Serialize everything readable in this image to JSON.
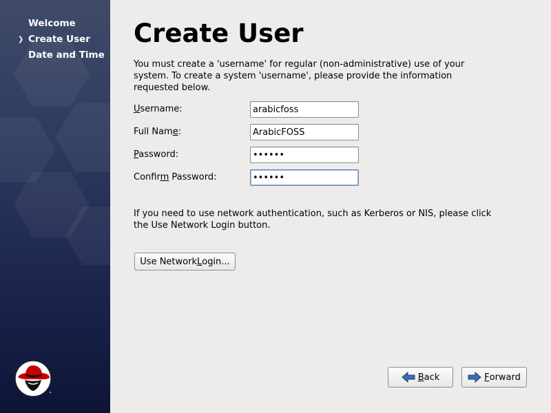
{
  "sidebar": {
    "items": [
      {
        "label": "Welcome",
        "current": false
      },
      {
        "label": "Create User",
        "current": true
      },
      {
        "label": "Date and Time",
        "current": false
      }
    ],
    "current_indicator": "chevron-right-icon",
    "logo": "redhat-shadowman-logo"
  },
  "main": {
    "title": "Create User",
    "intro": "You must create a 'username' for regular (non-administrative) use of your system.  To create a system 'username', please provide the information requested below.",
    "form": {
      "username": {
        "label_pre": "",
        "label_key": "U",
        "label_post": "sername:",
        "value": "arabicfoss"
      },
      "full_name": {
        "label_pre": "Full Nam",
        "label_key": "e",
        "label_post": ":",
        "value": "ArabicFOSS"
      },
      "password": {
        "label_pre": "",
        "label_key": "P",
        "label_post": "assword:",
        "value": "••••••"
      },
      "confirm_password": {
        "label_pre": "Confir",
        "label_key": "m",
        "label_post": " Password:",
        "value": "••••••"
      }
    },
    "network_note": "If you need to use network authentication, such as Kerberos or NIS, please click the Use Network Login button.",
    "network_button": {
      "pre": "Use Network ",
      "key": "L",
      "post": "ogin..."
    }
  },
  "footer": {
    "back": {
      "key": "B",
      "post": "ack",
      "icon": "arrow-left-icon"
    },
    "forward": {
      "key": "F",
      "post": "orward",
      "icon": "arrow-right-icon"
    }
  },
  "colors": {
    "sidebar_top": "#3f4b68",
    "sidebar_bottom": "#0d1436",
    "content_bg": "#edeceb",
    "arrow_blue": "#3b6cb3",
    "logo_red": "#cc0000"
  }
}
